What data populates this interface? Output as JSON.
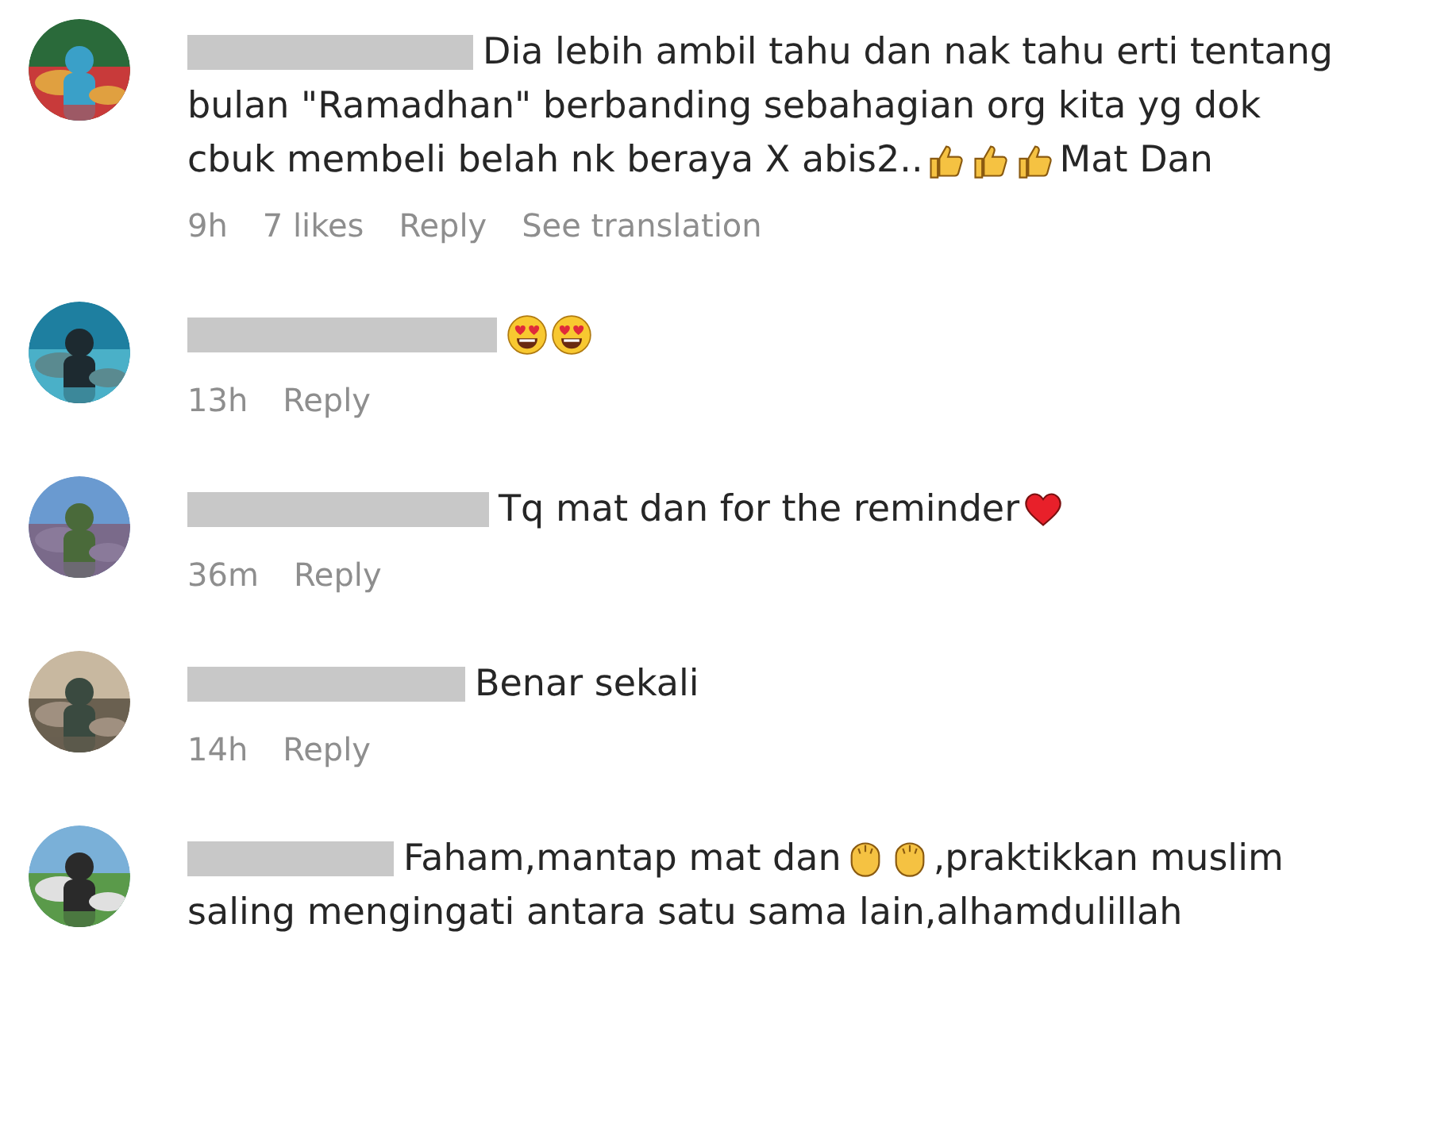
{
  "comments": [
    {
      "lines": [
        [
          {
            "kind": "text",
            "text": "Dia lebih ambil tahu dan nak tahu erti tentang"
          }
        ],
        [
          {
            "kind": "text",
            "text": "bulan \"Ramadhan\" berbanding sebahagian org kita yg dok"
          }
        ],
        [
          {
            "kind": "text",
            "text": "cbuk membeli belah nk beraya X abis2.."
          },
          {
            "kind": "thumbs"
          },
          {
            "kind": "thumbs"
          },
          {
            "kind": "thumbs"
          },
          {
            "kind": "text",
            "text": "Mat Dan"
          }
        ]
      ],
      "meta": [
        "9h",
        "7 likes"
      ],
      "actions": [
        "Reply",
        "See translation"
      ]
    },
    {
      "lines": [
        [
          {
            "kind": "hearteyes"
          },
          {
            "kind": "hearteyes"
          }
        ]
      ],
      "meta": [
        "13h"
      ],
      "actions": [
        "Reply"
      ]
    },
    {
      "lines": [
        [
          {
            "kind": "text",
            "text": "Tq mat dan for the reminder"
          },
          {
            "kind": "heart"
          }
        ]
      ],
      "meta": [
        "36m"
      ],
      "actions": [
        "Reply"
      ]
    },
    {
      "lines": [
        [
          {
            "kind": "text",
            "text": "Benar sekali"
          }
        ]
      ],
      "meta": [
        "14h"
      ],
      "actions": [
        "Reply"
      ]
    },
    {
      "lines": [
        [
          {
            "kind": "text",
            "text": "Faham,mantap mat dan"
          },
          {
            "kind": "clap"
          },
          {
            "kind": "clap"
          },
          {
            "kind": "text",
            "text": ",praktikkan muslim"
          }
        ],
        [
          {
            "kind": "text",
            "text": "saling mengingati antara satu sama lain,alhamdulillah"
          }
        ]
      ]
    }
  ]
}
